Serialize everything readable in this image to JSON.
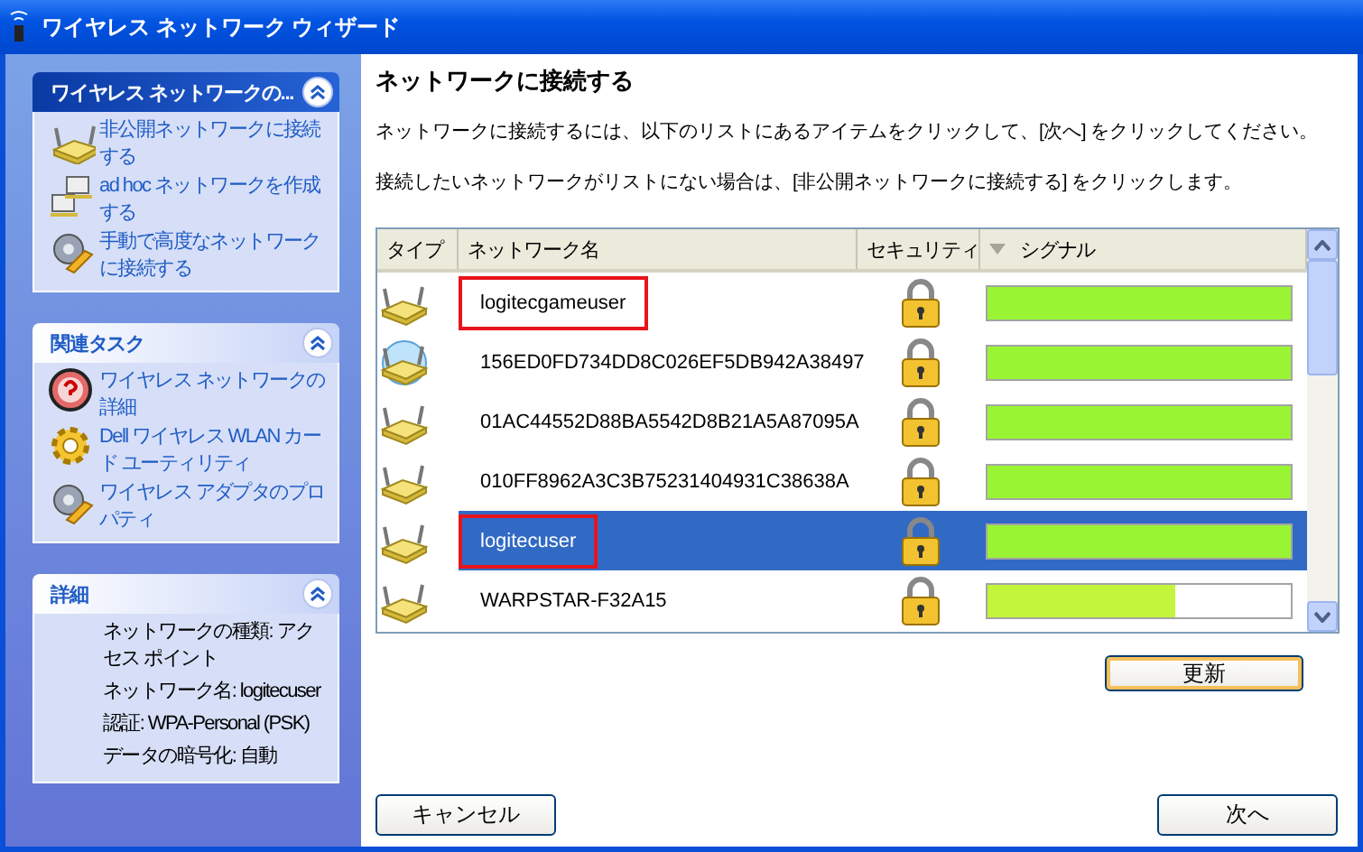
{
  "window": {
    "title": "ワイヤレス ネットワーク ウィザード"
  },
  "sidebar": [
    {
      "title": "ワイヤレス ネットワークの...",
      "kind": "tasks",
      "expanded": true,
      "items": [
        {
          "label": "非公開ネットワークに接続する",
          "kind": "router"
        },
        {
          "label": "ad hoc ネットワークを作成する",
          "kind": "computers"
        },
        {
          "label": "手動で高度なネットワークに接続する",
          "kind": "tools"
        }
      ]
    },
    {
      "title": "関連タスク",
      "kind": "tasks",
      "expanded": true,
      "items": [
        {
          "label": "ワイヤレス ネットワークの詳細",
          "kind": "help"
        },
        {
          "label": "Dell ワイヤレス WLAN カード ユーティリティ",
          "kind": "gear"
        },
        {
          "label": "ワイヤレス アダプタのプロパティ",
          "kind": "tools"
        }
      ]
    },
    {
      "title": "詳細",
      "kind": "details",
      "expanded": true,
      "lines": [
        "ネットワークの種類: アクセス ポイント",
        "ネットワーク名: logitecuser",
        "認証: WPA-Personal (PSK)",
        "データの暗号化: 自動"
      ]
    }
  ],
  "main": {
    "heading": "ネットワークに接続する",
    "paragraphs": [
      "ネットワークに接続するには、以下のリストにあるアイテムをクリックして、[次へ] をクリックしてください。",
      "接続したいネットワークがリストにない場合は、[非公開ネットワークに接続する] をクリックします。"
    ],
    "table": {
      "columns": [
        {
          "label": "タイプ",
          "sorted": false
        },
        {
          "label": "ネットワーク名",
          "sorted": false
        },
        {
          "label": "セキュリティ",
          "sorted": false
        },
        {
          "label": "シグナル",
          "sorted": true
        }
      ],
      "rows": [
        {
          "kind": "router",
          "name": "logitecgameuser",
          "secured": true,
          "level": 1.0,
          "selected": false,
          "highlighted": true
        },
        {
          "kind": "connected",
          "name": "156ED0FD734DD8C026EF5DB942A38497",
          "secured": true,
          "level": 1.0,
          "selected": false,
          "highlighted": false
        },
        {
          "kind": "router",
          "name": "01AC44552D88BA5542D8B21A5A87095A",
          "secured": true,
          "level": 1.0,
          "selected": false,
          "highlighted": false
        },
        {
          "kind": "router",
          "name": "010FF8962A3C3B75231404931C38638A",
          "secured": true,
          "level": 1.0,
          "selected": false,
          "highlighted": false
        },
        {
          "kind": "router",
          "name": "logitecuser",
          "secured": true,
          "level": 1.0,
          "selected": true,
          "highlighted": true
        },
        {
          "kind": "router",
          "name": "WARPSTAR-F32A15",
          "secured": true,
          "level": 0.62,
          "selected": false,
          "highlighted": false
        }
      ]
    },
    "refresh_button": "更新"
  },
  "buttons": {
    "cancel": "キャンセル",
    "next": "次へ"
  }
}
